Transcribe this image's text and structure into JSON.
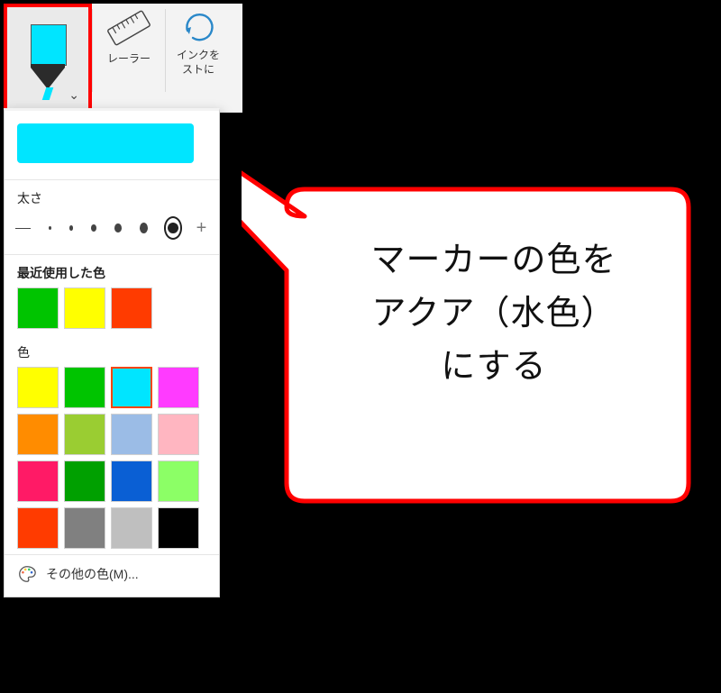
{
  "ribbon": {
    "marker_current_color": "#00e5ff",
    "ruler_label": "レーラー",
    "ink_label_l1": "インクを",
    "ink_label_l2": "ストに"
  },
  "popup": {
    "thickness_title": "太さ",
    "recent_title": "最近使用した色",
    "recent_colors": [
      "#00c400",
      "#ffff00",
      "#ff3b00"
    ],
    "colors_title": "色",
    "selected_color": "#00e5ff",
    "palette": [
      [
        "#ffff00",
        "#00c400",
        "#00e5ff",
        "#ff3bff"
      ],
      [
        "#ff8c00",
        "#9acd32",
        "#9bbce6",
        "#ffb6c1"
      ],
      [
        "#ff1a66",
        "#00a000",
        "#0a5fd4",
        "#8cff66"
      ],
      [
        "#ff3b00",
        "#808080",
        "#bfbfbf",
        "#000000"
      ]
    ],
    "more_colors_label": "その他の色(M)..."
  },
  "callout": {
    "line1": "マーカーの色を",
    "line2": "アクア（水色）",
    "line3": "にする"
  }
}
